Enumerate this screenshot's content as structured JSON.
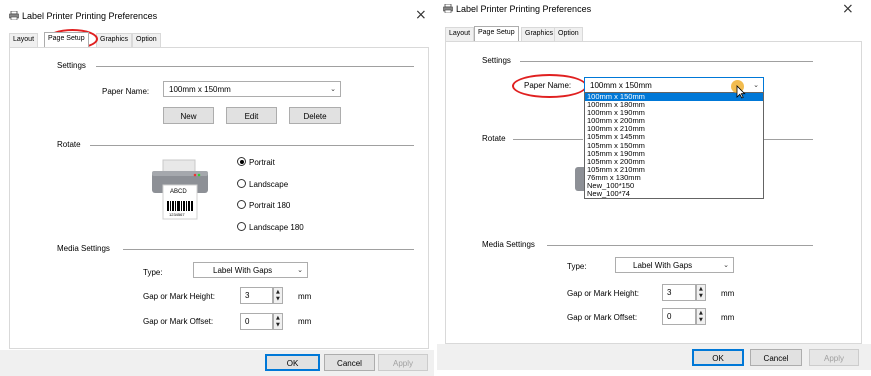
{
  "left": {
    "title": "Label Printer Printing Preferences",
    "close": "×",
    "tabs": [
      "Layout",
      "Page Setup",
      "Graphics",
      "Option"
    ],
    "settings_label": "Settings",
    "paper_name_label": "Paper Name:",
    "paper_name_value": "100mm x 150mm",
    "buttons": {
      "new": "New",
      "edit": "Edit",
      "delete": "Delete"
    },
    "rotate_label": "Rotate",
    "orientations": [
      "Portrait",
      "Landscape",
      "Portrait 180",
      "Landscape 180"
    ],
    "selected_orientation": "Portrait",
    "printer_label_text": "ABCD",
    "printer_barcode_text": "1234567",
    "media_label": "Media Settings",
    "type_label": "Type:",
    "type_value": "Label With Gaps",
    "gap_height_label": "Gap or Mark Height:",
    "gap_height_value": "3",
    "gap_offset_label": "Gap or Mark Offset:",
    "gap_offset_value": "0",
    "unit": "mm",
    "footer": {
      "ok": "OK",
      "cancel": "Cancel",
      "apply": "Apply"
    }
  },
  "right": {
    "title": "Label Printer Printing Preferences",
    "close": "×",
    "tabs": [
      "Layout",
      "Page Setup",
      "Graphics",
      "Option"
    ],
    "settings_label": "Settings",
    "paper_name_label": "Paper Name:",
    "paper_name_value": "100mm x 150mm",
    "paper_options": [
      "100mm x 150mm",
      "100mm x 180mm",
      "100mm x 190mm",
      "100mm x 200mm",
      "100mm x 210mm",
      "105mm x 145mm",
      "105mm x 150mm",
      "105mm x 190mm",
      "105mm x 200mm",
      "105mm x 210mm",
      "76mm x 130mm",
      "New_100*150",
      "New_100*74"
    ],
    "rotate_label": "Rotate",
    "media_label": "Media Settings",
    "type_label": "Type:",
    "type_value": "Label With Gaps",
    "gap_height_label": "Gap or Mark Height:",
    "gap_height_value": "3",
    "gap_offset_label": "Gap or Mark Offset:",
    "gap_offset_value": "0",
    "unit": "mm",
    "footer": {
      "ok": "OK",
      "cancel": "Cancel",
      "apply": "Apply"
    }
  },
  "colors": {
    "annotation": "#e02020",
    "selection": "#0078d7",
    "cursor_highlight": "#f0b030"
  }
}
